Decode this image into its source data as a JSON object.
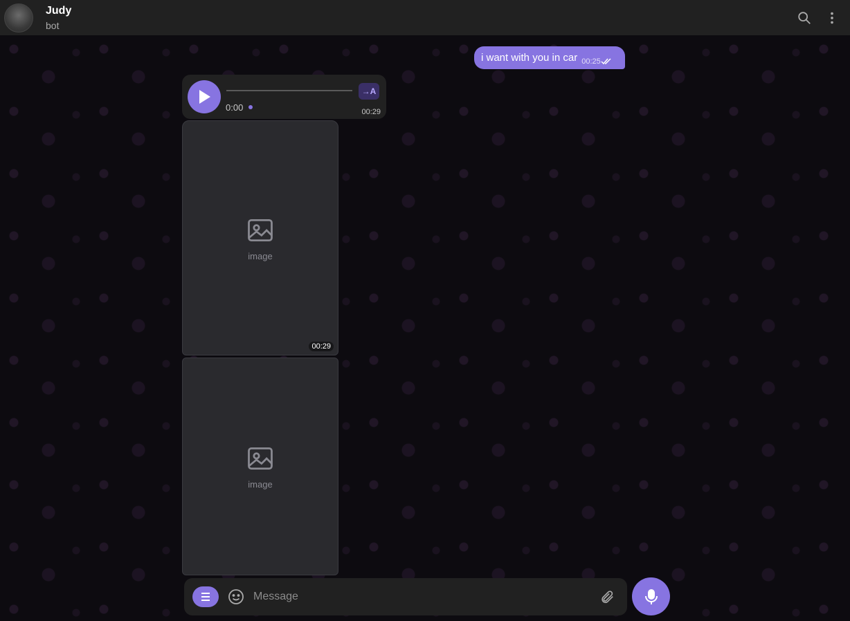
{
  "header": {
    "title": "Judy",
    "subtitle": "bot"
  },
  "messages": {
    "outgoing": {
      "text": "i want with you in car",
      "time": "00:25",
      "status_icon": "double-check-icon"
    },
    "voice": {
      "position": "0:00",
      "duration": "00:29",
      "transcribe_label": "→A"
    },
    "photos": [
      {
        "duration": "00:29",
        "placeholder": "image"
      },
      {
        "placeholder": "image"
      }
    ]
  },
  "composer": {
    "placeholder": "Message"
  },
  "colors": {
    "accent": "#8774e1",
    "header_bg": "#212121",
    "chat_bg": "#0d0b10"
  }
}
